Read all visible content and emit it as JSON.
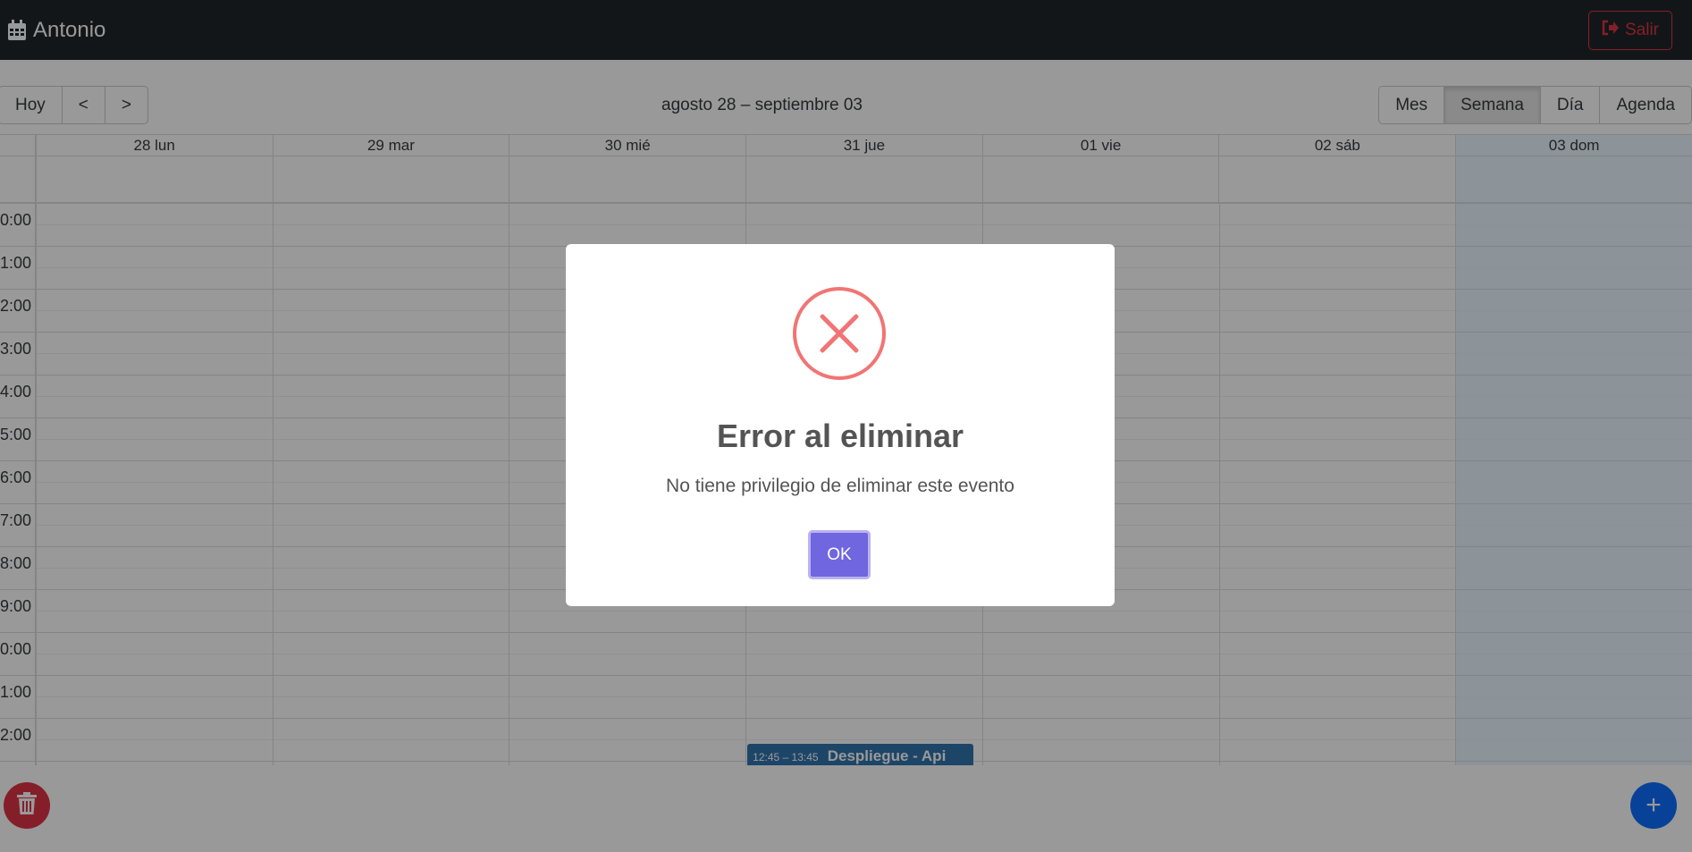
{
  "navbar": {
    "brand_icon": "calendar-icon",
    "brand_name": "Antonio",
    "logout_icon": "sign-out-icon",
    "logout_label": "Salir"
  },
  "toolbar": {
    "today_label": "Hoy",
    "prev_label": "<",
    "next_label": ">",
    "range_label": "agosto 28 – septiembre 03",
    "views": [
      "Mes",
      "Semana",
      "Día",
      "Agenda"
    ],
    "active_view": "Semana"
  },
  "calendar": {
    "days": [
      "28 lun",
      "29 mar",
      "30 mié",
      "31 jue",
      "01 vie",
      "02 sáb",
      "03 dom"
    ],
    "today": "03 dom",
    "hours": [
      "0:00",
      "1:00",
      "2:00",
      "3:00",
      "4:00",
      "5:00",
      "6:00",
      "7:00",
      "8:00",
      "9:00",
      "0:00",
      "1:00",
      "2:00"
    ],
    "event": {
      "day": "31 jue",
      "time": "12:45 – 13:45",
      "title": "Despliegue - Api"
    }
  },
  "fabs": {
    "delete_icon": "trash-icon",
    "add_label": "+"
  },
  "modal": {
    "icon": "error-x-icon",
    "title": "Error al eliminar",
    "text": "No tiene privilegio de eliminar este evento",
    "ok_label": "OK"
  },
  "colors": {
    "navbar": "#212529",
    "danger": "#dc3545",
    "primary": "#0d6efd",
    "today_bg": "#eaf6ff",
    "event_bg": "#3174ad",
    "modal_error": "#f27474",
    "modal_confirm": "#7066e0"
  }
}
